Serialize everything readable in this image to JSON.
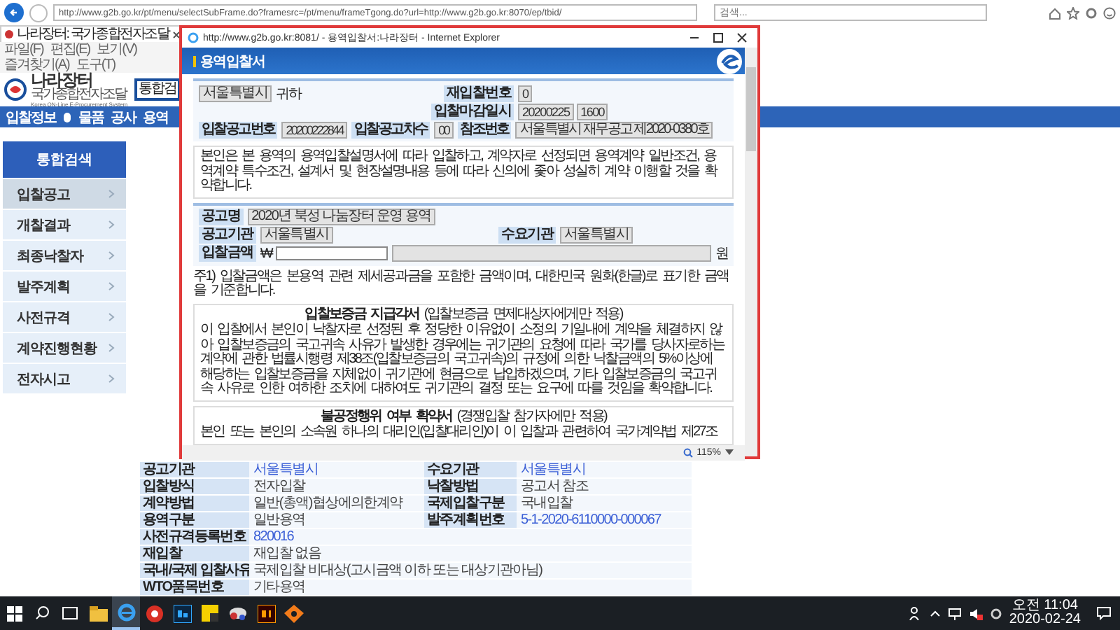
{
  "browser": {
    "address": "http://www.g2b.go.kr/pt/menu/selectSubFrame.do?framesrc=/pt/menu/frameTgong.do?url=http://www.g2b.go.kr:8070/ep/tbid/",
    "search_placeholder": "검색...",
    "tabs": [
      {
        "label": "나라장터: 국가종합전자조달",
        "selected": true
      }
    ],
    "menu": [
      "파일(F)",
      "편집(E)",
      "보기(V)",
      "즐겨찾기(A)",
      "도구(T)"
    ]
  },
  "site": {
    "logo_title": "나라장터",
    "logo_subtitle": "국가종합전자조달",
    "logo_english": "Korea ON-Line E-Procurement System",
    "search_label": "통합검",
    "nav": [
      "입찰정보",
      "물품",
      "공사",
      "용역"
    ],
    "sidebar": {
      "title": "통합검색",
      "items": [
        {
          "label": "입찰공고",
          "selected": true
        },
        {
          "label": "개찰결과",
          "selected": false
        },
        {
          "label": "최종낙찰자",
          "selected": false
        },
        {
          "label": "발주계획",
          "selected": false
        },
        {
          "label": "사전규격",
          "selected": false
        },
        {
          "label": "계약진행현황",
          "selected": false
        },
        {
          "label": "전자시고",
          "selected": false
        }
      ]
    },
    "detail_rows": [
      {
        "cells": [
          {
            "label": "공고기관",
            "value": "서울특별시",
            "link": true
          },
          {
            "label": "수요기관",
            "value": "서울특별시",
            "link": true
          }
        ]
      },
      {
        "cells": [
          {
            "label": "입찰방식",
            "value": "전자입찰",
            "link": false
          },
          {
            "label": "낙찰방법",
            "value": "공고서 참조",
            "link": false
          }
        ]
      },
      {
        "cells": [
          {
            "label": "계약방법",
            "value": "일반(총액)협상에의한계약",
            "link": false
          },
          {
            "label": "국제입찰구분",
            "value": "국내입찰",
            "link": false
          }
        ]
      },
      {
        "cells": [
          {
            "label": "용역구분",
            "value": "일반용역",
            "link": false
          },
          {
            "label": "발주계획번호",
            "value": "5-1-2020-6110000-000067",
            "link": true
          }
        ]
      },
      {
        "cells": [
          {
            "label": "사전규격등록번호",
            "value": "820016",
            "link": true
          }
        ]
      },
      {
        "cells": [
          {
            "label": "재입찰",
            "value": "재입찰 없음",
            "link": false
          }
        ]
      },
      {
        "cells": [
          {
            "label": "국내/국제 입찰사유",
            "value": "국제입찰 비대상(고시금액 이하 또는 대상기관아님)",
            "link": false
          }
        ]
      },
      {
        "cells": [
          {
            "label": "WTO품목번호",
            "value": "기타용역",
            "link": false
          }
        ]
      }
    ]
  },
  "popup": {
    "title": "http://www.g2b.go.kr:8081/ - 용역입찰서:나라장터 - Internet Explorer",
    "header": "용역입찰서",
    "recipient": "서울특별시",
    "recipient_suffix": "귀하",
    "rebid_label": "재입찰번호",
    "rebid_value": "0",
    "deadline_label": "입찰마감일시",
    "deadline_date": "20200225",
    "deadline_time": "1600",
    "notice_no_label": "입찰공고번호",
    "notice_no": "20200222844",
    "notice_round_label": "입찰공고차수",
    "notice_round": "00",
    "ref_label": "참조번호",
    "ref_value": "서울특별시 재무공고 제2020-0380호",
    "pledge": "본인은 본 용역의 용역입찰설명서에 따라 입찰하고, 계약자로 선정되면 용역계약 일반조건, 용역계약 특수조건, 설계서 및 현장설명내용 등에 따라 신의에 좇아 성실히 계약 이행할 것을 확약합니다.",
    "name_label": "공고명",
    "name_value": "2020년 북성 나눔장터 운영 용역",
    "agency_label": "공고기관",
    "agency_value": "서울특별시",
    "demand_label": "수요기관",
    "demand_value": "서울특별시",
    "amount_label": "입찰금액",
    "currency": "₩",
    "unit": "원",
    "note": "주1) 입찰금액은 본용역 관련 제세공과금을 포함한 금액이며, 대한민국 원화(한글)로 표기한 금액을 기준합니다.",
    "sections": [
      {
        "title": "**입찰보증금 지급각서** (입찰보증금 면제대상자에게만 적용)",
        "body": "이 입찰에서 본인이 낙찰자로 선정된 후 정당한 이유없이 소정의 기일내에 계약을 체결하지 않아 입찰보증금의 국고귀속 사유가 발생한 경우에는 귀기관의 요청에 따라 국가를 당사자로하는 계약에 관한 법률시행령 제38조(입찰보증금의 국고귀속)의 규정에 의한 낙찰금액의 5%이상에 해당하는 입찰보증금을 지체없이 귀기관에 현금으로 납입하겠으며, 기타 입찰보증금의 국고귀속 사유로 인한 여하한 조치에 대하여도 귀기관의 결정 또는 요구에 따를 것임을 확약합니다."
      },
      {
        "title": "**불공정행위 여부 확약서** (경쟁입찰 참가자에만 적용)",
        "body": "본인 또는 본인의 소속원 하나의 대리인(입찰대리인)이 이 입찰과 관련하여 국가계약법 제27조"
      }
    ],
    "zoom": "115%"
  },
  "taskbar": {
    "apps": [
      {
        "kind": "explorer",
        "selected": false
      },
      {
        "kind": "ie",
        "selected": true
      },
      {
        "kind": "chrome",
        "selected": false
      },
      {
        "kind": "photoshop",
        "selected": false
      },
      {
        "kind": "note",
        "selected": false
      },
      {
        "kind": "bird",
        "selected": false
      },
      {
        "kind": "illustrator",
        "selected": false
      },
      {
        "kind": "diamond",
        "selected": false
      }
    ],
    "time": "오전 11:04",
    "date": "2020-02-24"
  }
}
